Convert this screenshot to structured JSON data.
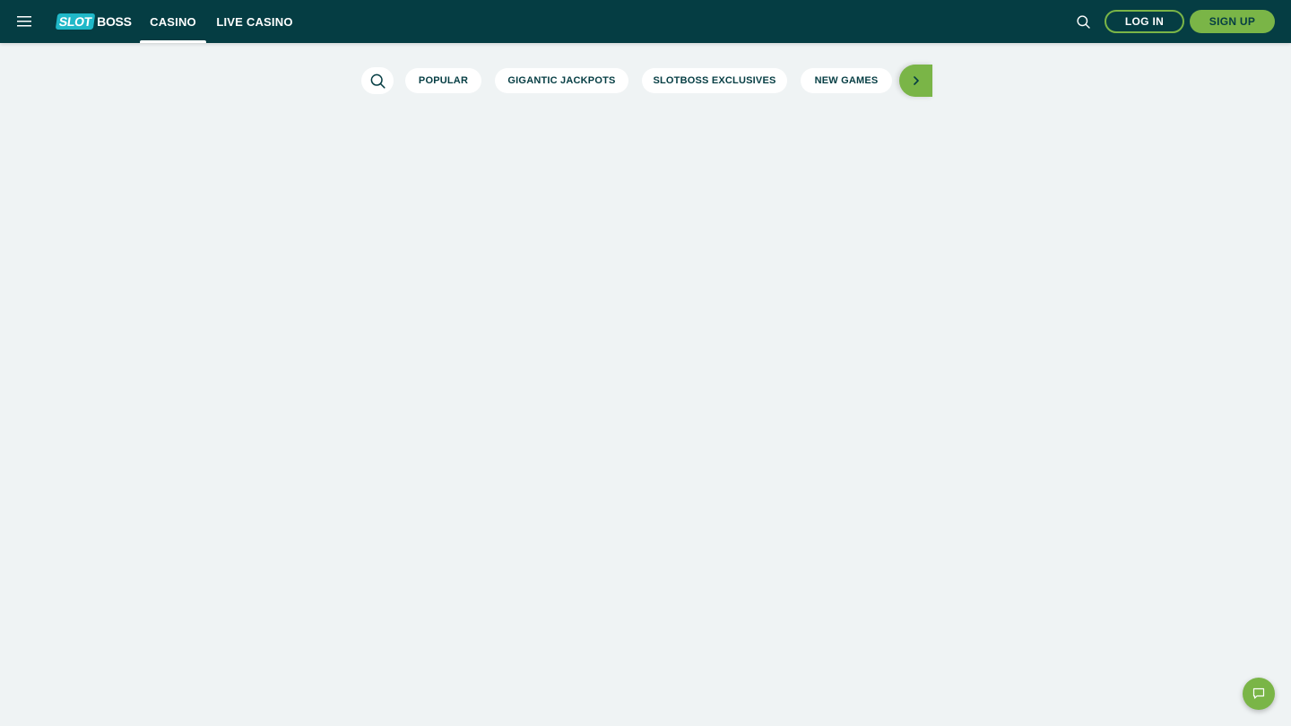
{
  "header": {
    "logo": {
      "part1": "SLOT",
      "part2": "BOSS"
    },
    "nav": [
      {
        "label": "CASINO",
        "active": true
      },
      {
        "label": "LIVE CASINO",
        "active": false
      }
    ],
    "login_label": "LOG IN",
    "signup_label": "SIGN UP"
  },
  "filters": {
    "categories": [
      {
        "label": "POPULAR"
      },
      {
        "label": "GIGANTIC JACKPOTS"
      },
      {
        "label": "SLOTBOSS EXCLUSIVES"
      },
      {
        "label": "NEW GAMES"
      }
    ]
  },
  "icons": {
    "menu": "hamburger-menu-icon",
    "search": "search-icon",
    "next": "chevron-right-icon",
    "chat": "chat-bubble-icon"
  },
  "colors": {
    "header_bg": "#053d43",
    "accent_green": "#7ab547",
    "logo_teal": "#20b8c8",
    "page_bg": "#eff3f4"
  }
}
